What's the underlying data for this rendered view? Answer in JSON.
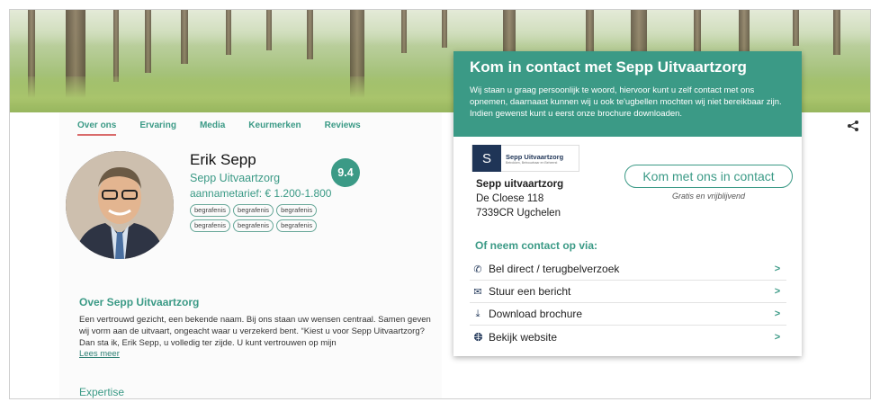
{
  "tabs": [
    {
      "label": "Over ons",
      "active": true
    },
    {
      "label": "Ervaring",
      "active": false
    },
    {
      "label": "Media",
      "active": false
    },
    {
      "label": "Keurmerken",
      "active": false
    },
    {
      "label": "Reviews",
      "active": false
    }
  ],
  "profile": {
    "name": "Erik Sepp",
    "company": "Sepp Uitvaartzorg",
    "tariff_label": "aannametarief:",
    "tariff_value": "€ 1.200-1.800",
    "score": "9.4",
    "tags": [
      "begrafenis",
      "begrafenis",
      "begrafenis",
      "begrafenis",
      "begrafenis",
      "begrafenis"
    ]
  },
  "about": {
    "title": "Over Sepp Uitvaartzorg",
    "text": "Een vertrouwd gezicht, een bekende naam. Bij ons staan uw wensen centraal. Samen geven wij vorm aan de uitvaart, ongeacht waar u verzekerd bent.  “Kiest u voor Sepp Uitvaartzorg? Dan sta ik, Erik Sepp, u volledig ter zijde. U kunt vertrouwen op mijn",
    "read_more": "Lees meer",
    "expertise": "Expertise"
  },
  "contact": {
    "title": "Kom in contact met Sepp Uitvaartzorg",
    "intro": "Wij staan u graag persoonlijk  te woord, hiervoor kunt u zelf contact met ons opnemen, daarnaast kunnen wij u ook te'ugbellen mochten wij niet bereikbaar zijn. Indien gewenst kunt u eerst onze brochure downloaden.",
    "logo_name": "Sepp Uitvaartzorg",
    "logo_tagline": "Betrokken, Betrouwbaar en Beheerst",
    "logo_glyph": "S",
    "address_name": "Sepp uitvaartzorg",
    "street": "De Cloese 118",
    "city": "7339CR Ugchelen",
    "cta_label": "Kom met ons in contact",
    "cta_sub": "Gratis en vrijblijvend",
    "via_title": "Of neem contact op via:",
    "options": [
      {
        "icon": "phone-icon",
        "glyph": "✆",
        "label": "Bel direct  / terugbelverzoek",
        "arrow": ">"
      },
      {
        "icon": "envelope-icon",
        "glyph": "✉",
        "label": "Stuur een bericht",
        "arrow": ">"
      },
      {
        "icon": "download-icon",
        "glyph": "⤓",
        "label": "Download brochure",
        "arrow": ">"
      },
      {
        "icon": "globe-icon",
        "glyph": "🌐",
        "label": "Bekijk website",
        "arrow": ">"
      }
    ]
  },
  "colors": {
    "accent": "#3b9a86",
    "tab_underline": "#d96b6b",
    "logo_navy": "#1f3557"
  }
}
